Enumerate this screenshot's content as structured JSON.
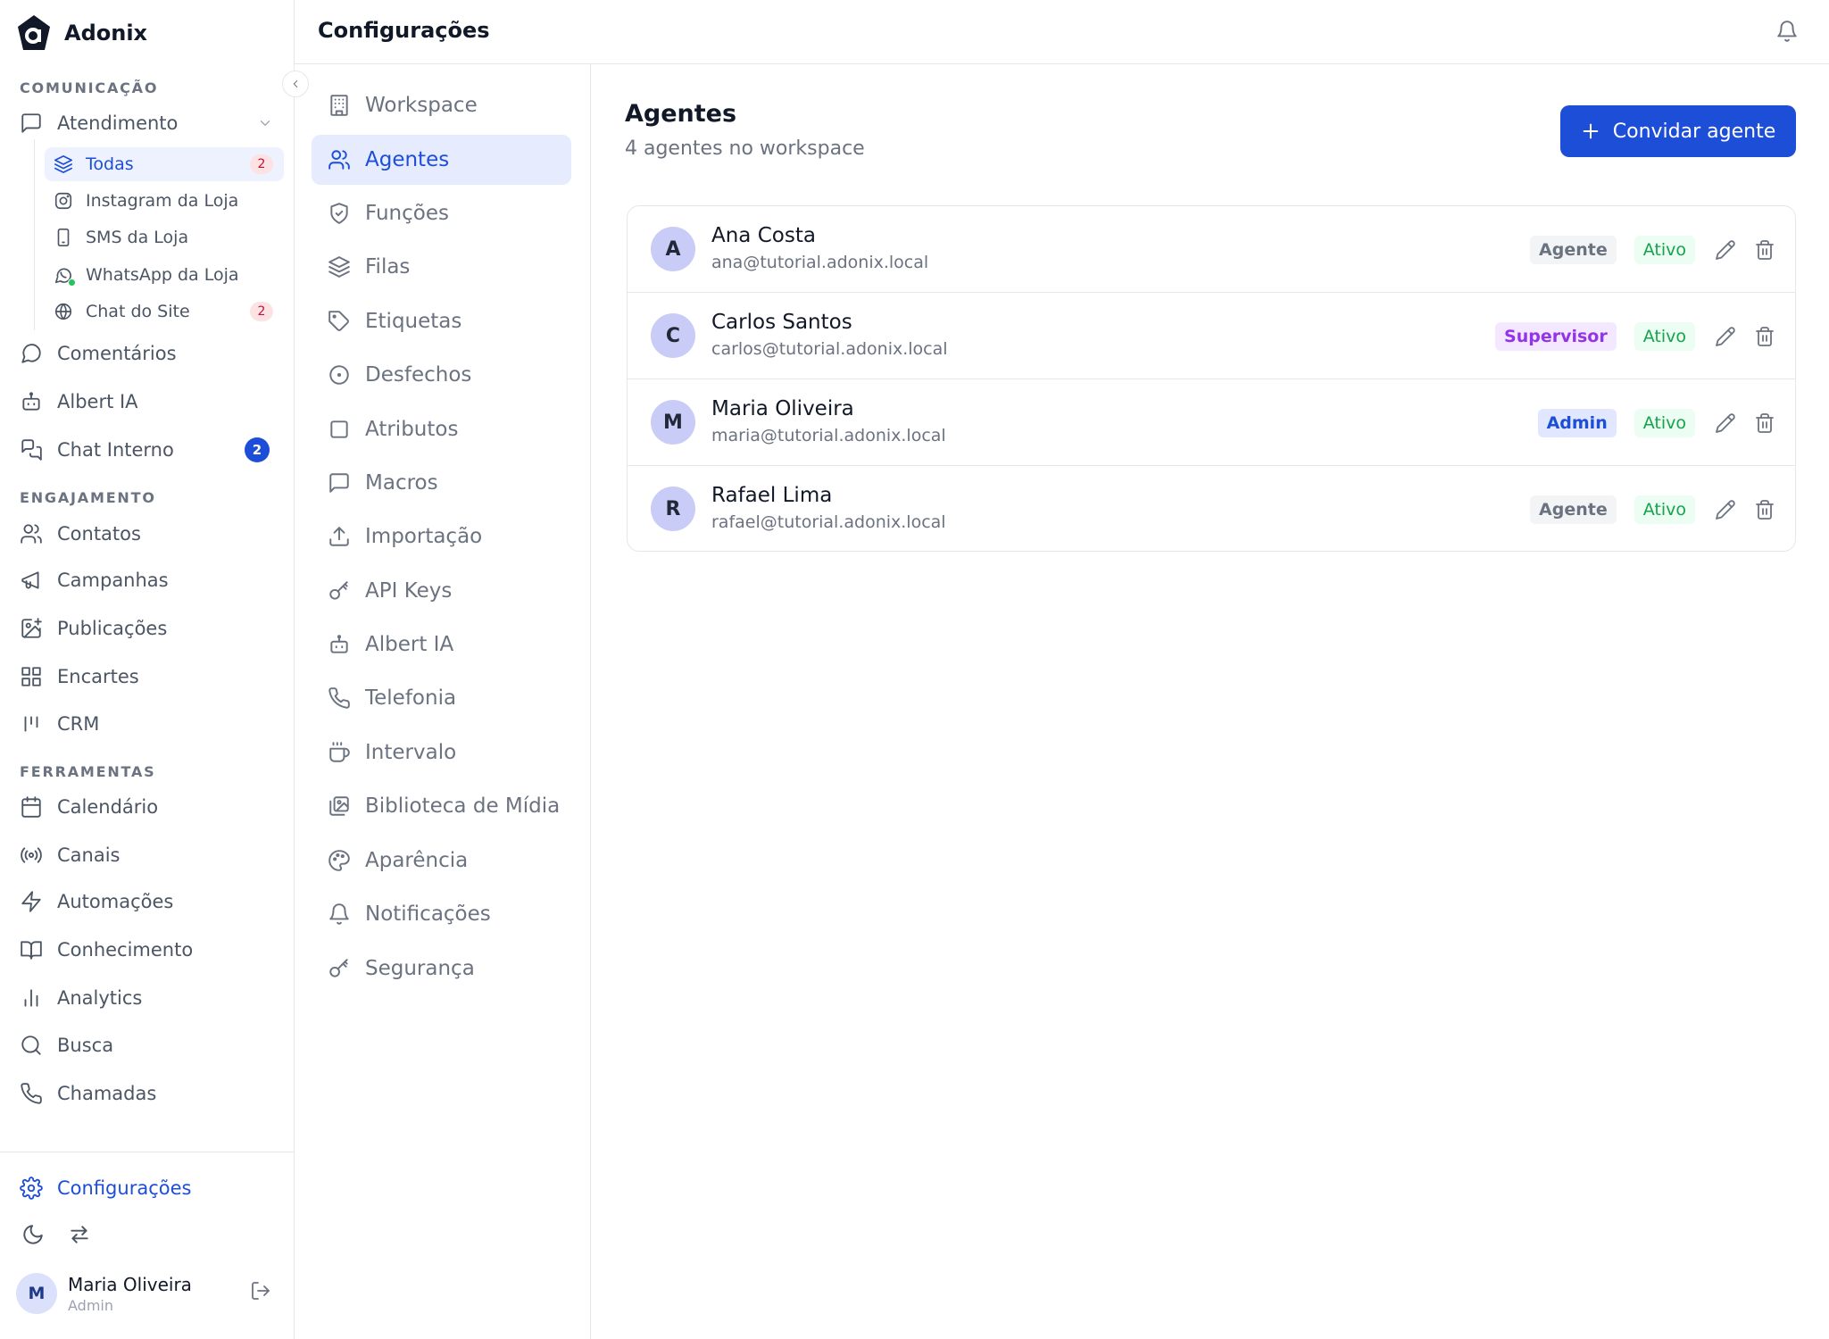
{
  "app": {
    "name": "Adonix"
  },
  "sidebar": {
    "sections": {
      "comunicacao": "COMUNICAÇÃO",
      "engajamento": "ENGAJAMENTO",
      "ferramentas": "FERRAMENTAS"
    },
    "atendimento": {
      "label": "Atendimento",
      "subitems": [
        {
          "label": "Todas",
          "count": "2",
          "icon": "layers-icon"
        },
        {
          "label": "Instagram da Loja",
          "icon": "instagram-icon"
        },
        {
          "label": "SMS da Loja",
          "icon": "phone-device-icon"
        },
        {
          "label": "WhatsApp da Loja",
          "icon": "whatsapp-icon"
        },
        {
          "label": "Chat do Site",
          "count": "2",
          "icon": "globe-icon"
        }
      ]
    },
    "comunicacao_items": [
      {
        "label": "Comentários",
        "icon": "comment-icon"
      },
      {
        "label": "Albert IA",
        "icon": "bot-icon"
      },
      {
        "label": "Chat Interno",
        "count": "2",
        "icon": "chat-internal-icon"
      }
    ],
    "engajamento_items": [
      {
        "label": "Contatos",
        "icon": "users-icon"
      },
      {
        "label": "Campanhas",
        "icon": "megaphone-icon"
      },
      {
        "label": "Publicações",
        "icon": "image-plus-icon"
      },
      {
        "label": "Encartes",
        "icon": "grid-icon"
      },
      {
        "label": "CRM",
        "icon": "kanban-icon"
      }
    ],
    "ferramentas_items": [
      {
        "label": "Calendário",
        "icon": "calendar-icon"
      },
      {
        "label": "Canais",
        "icon": "radio-icon"
      },
      {
        "label": "Automações",
        "icon": "zap-icon"
      },
      {
        "label": "Conhecimento",
        "icon": "book-icon"
      },
      {
        "label": "Analytics",
        "icon": "bar-chart-icon"
      },
      {
        "label": "Busca",
        "icon": "search-icon"
      },
      {
        "label": "Chamadas",
        "icon": "phone-icon"
      }
    ],
    "settings_label": "Configurações",
    "user": {
      "initial": "M",
      "name": "Maria Oliveira",
      "role": "Admin"
    }
  },
  "header": {
    "title": "Configurações"
  },
  "settings_nav": [
    {
      "label": "Workspace",
      "icon": "building-icon"
    },
    {
      "label": "Agentes",
      "icon": "users-icon"
    },
    {
      "label": "Funções",
      "icon": "shield-icon"
    },
    {
      "label": "Filas",
      "icon": "layers-icon"
    },
    {
      "label": "Etiquetas",
      "icon": "tag-icon"
    },
    {
      "label": "Desfechos",
      "icon": "circle-dot-icon"
    },
    {
      "label": "Atributos",
      "icon": "square-icon"
    },
    {
      "label": "Macros",
      "icon": "message-square-icon"
    },
    {
      "label": "Importação",
      "icon": "upload-icon"
    },
    {
      "label": "API Keys",
      "icon": "key-icon"
    },
    {
      "label": "Albert IA",
      "icon": "bot-icon"
    },
    {
      "label": "Telefonia",
      "icon": "phone-icon"
    },
    {
      "label": "Intervalo",
      "icon": "coffee-icon"
    },
    {
      "label": "Biblioteca de Mídia",
      "icon": "images-icon"
    },
    {
      "label": "Aparência",
      "icon": "palette-icon"
    },
    {
      "label": "Notificações",
      "icon": "bell-icon"
    },
    {
      "label": "Segurança",
      "icon": "key-icon"
    }
  ],
  "main": {
    "title": "Agentes",
    "subtitle": "4 agentes no workspace",
    "invite_label": "Convidar agente",
    "agents": [
      {
        "initial": "A",
        "name": "Ana Costa",
        "email": "ana@tutorial.adonix.local",
        "role": "Agente",
        "status": "Ativo"
      },
      {
        "initial": "C",
        "name": "Carlos Santos",
        "email": "carlos@tutorial.adonix.local",
        "role": "Supervisor",
        "status": "Ativo"
      },
      {
        "initial": "M",
        "name": "Maria Oliveira",
        "email": "maria@tutorial.adonix.local",
        "role": "Admin",
        "status": "Ativo"
      },
      {
        "initial": "R",
        "name": "Rafael Lima",
        "email": "rafael@tutorial.adonix.local",
        "role": "Agente",
        "status": "Ativo"
      }
    ]
  },
  "colors": {
    "accent": "#1d4ed8",
    "active_bg": "#e6ebfd",
    "success": "#16a34a",
    "supervisor": "#9333ea"
  }
}
